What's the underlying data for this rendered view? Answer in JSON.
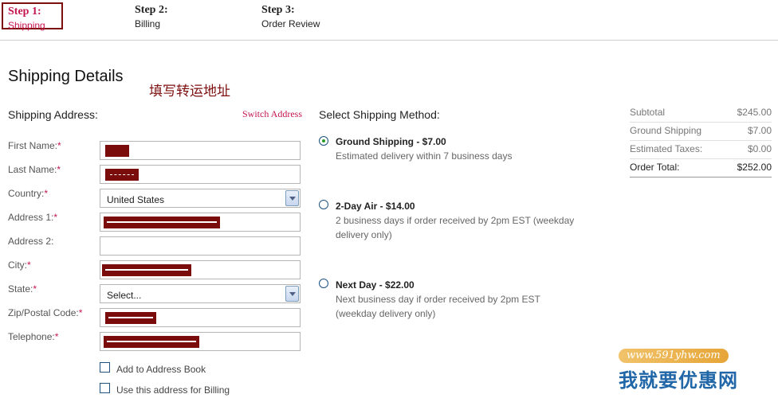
{
  "steps": [
    {
      "title": "Step 1:",
      "sub": "Shipping"
    },
    {
      "title": "Step 2:",
      "sub": "Billing"
    },
    {
      "title": "Step 3:",
      "sub": "Order Review"
    }
  ],
  "page_title": "Shipping Details",
  "note": "填写转运地址",
  "address": {
    "title": "Shipping Address:",
    "switch_link": "Switch Address",
    "fields": {
      "first_name": "First Name:",
      "last_name": "Last Name:",
      "country": "Country:",
      "address1": "Address 1:",
      "address2": "Address 2:",
      "city": "City:",
      "state": "State:",
      "zip": "Zip/Postal Code:",
      "telephone": "Telephone:"
    },
    "required_mark": "*",
    "country_value": "United States",
    "state_value": "Select...",
    "checkboxes": {
      "add_to_book": "Add to Address Book",
      "use_for_billing": "Use this address for Billing"
    }
  },
  "shipping": {
    "title": "Select Shipping Method:",
    "options": [
      {
        "title": "Ground Shipping - $7.00",
        "desc": "Estimated delivery within 7 business days",
        "selected": true
      },
      {
        "title": "2-Day Air - $14.00",
        "desc1": "2 business days if order received by 2pm EST (weekday",
        "desc2": "delivery only)",
        "selected": false
      },
      {
        "title": "Next Day - $22.00",
        "desc1": "Next business day if order received by 2pm EST",
        "desc2": "(weekday delivery only)",
        "selected": false
      }
    ]
  },
  "summary": [
    {
      "label": "Subtotal",
      "value": "$245.00"
    },
    {
      "label": "Ground Shipping",
      "value": "$7.00"
    },
    {
      "label": "Estimated Taxes:",
      "value": "$0.00"
    },
    {
      "label": "Order Total:",
      "value": "$252.00"
    }
  ],
  "watermark": {
    "url": "www.591yhw.com",
    "text": "我就要优惠网"
  },
  "colors": {
    "accent": "#c4164e",
    "redaction": "#7b0c0c",
    "link_blue": "#2167a8"
  }
}
